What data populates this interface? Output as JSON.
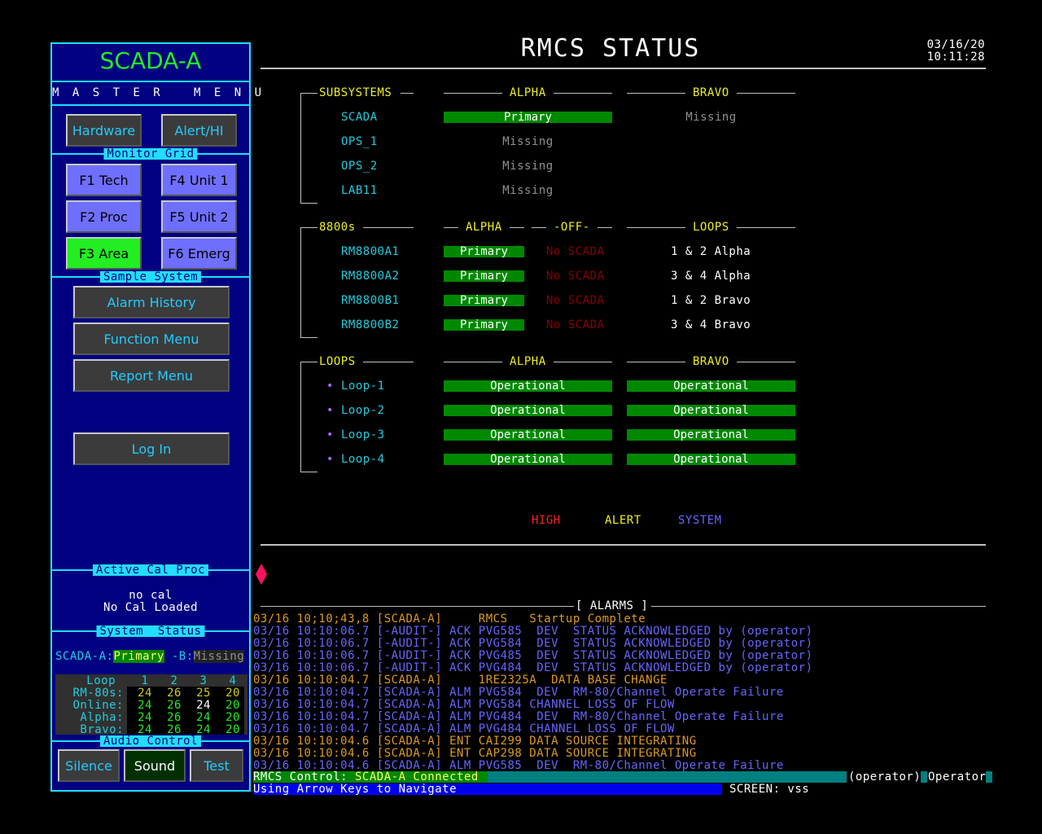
{
  "sidebar": {
    "title": "SCADA-A",
    "menu_label": "M A S T E R   M E N U",
    "hardware_btn": "Hardware",
    "alert_btn": "Alert/HI",
    "monitor_grid_label": "Monitor Grid",
    "monitor_grid": [
      "F1 Tech",
      "F4 Unit 1",
      "F2 Proc",
      "F5 Unit 2",
      "F3 Area",
      "F6 Emerg"
    ],
    "sample_system_label": "Sample System",
    "alarm_history_btn": "Alarm History",
    "function_menu_btn": "Function Menu",
    "report_menu_btn": "Report Menu",
    "login_btn": "Log In",
    "active_cal_label": "Active Cal Proc",
    "cal_line1": "no cal",
    "cal_line2": "No Cal Loaded",
    "system_status_label": "System  Status",
    "status_a_label": "SCADA-A:",
    "status_a_value": "Primary",
    "status_b_label": " -B:",
    "status_b_value": "Missing",
    "loop_table": {
      "headers": [
        "Loop",
        "1",
        "2",
        "3",
        "4"
      ],
      "rows": [
        {
          "label": "RM-80s:",
          "values": [
            "24",
            "26",
            "25",
            "20"
          ]
        },
        {
          "label": "Online:",
          "values": [
            "24",
            "26",
            "24",
            "20"
          ]
        },
        {
          "label": "Alpha:",
          "values": [
            "24",
            "26",
            "24",
            "20"
          ]
        },
        {
          "label": "Bravo:",
          "values": [
            "24",
            "26",
            "24",
            "20"
          ]
        }
      ]
    },
    "audio_control_label": "Audio Control",
    "silence_btn": "Silence",
    "sound_btn": "Sound",
    "test_btn": "Test"
  },
  "header": {
    "title": "RMCS STATUS",
    "date": "03/16/20",
    "time": "10:11:28"
  },
  "subsystems": {
    "header": "SUBSYSTEMS",
    "col_alpha": "ALPHA",
    "col_bravo": "BRAVO",
    "rows": [
      {
        "name": "SCADA",
        "alpha": "Primary",
        "bravo": "Missing"
      },
      {
        "name": "OPS_1",
        "alpha": "Missing",
        "bravo": ""
      },
      {
        "name": "OPS_2",
        "alpha": "Missing",
        "bravo": ""
      },
      {
        "name": "LAB11",
        "alpha": "Missing",
        "bravo": ""
      }
    ]
  },
  "rm8800s": {
    "header": "8800s",
    "col_alpha": "ALPHA",
    "col_off": "-OFF-",
    "col_loops": "LOOPS",
    "rows": [
      {
        "name": "RM8800A1",
        "alpha": "Primary",
        "off": "No SCADA",
        "loops": "1 & 2 Alpha"
      },
      {
        "name": "RM8800A2",
        "alpha": "Primary",
        "off": "No SCADA",
        "loops": "3 & 4 Alpha"
      },
      {
        "name": "RM8800B1",
        "alpha": "Primary",
        "off": "No SCADA",
        "loops": "1 & 2 Bravo"
      },
      {
        "name": "RM8800B2",
        "alpha": "Primary",
        "off": "No SCADA",
        "loops": "3 & 4 Bravo"
      }
    ]
  },
  "loops": {
    "header": "LOOPS",
    "col_alpha": "ALPHA",
    "col_bravo": "BRAVO",
    "bullet": "•",
    "rows": [
      {
        "name": "Loop-1",
        "alpha": "Operational",
        "bravo": "Operational"
      },
      {
        "name": "Loop-2",
        "alpha": "Operational",
        "bravo": "Operational"
      },
      {
        "name": "Loop-3",
        "alpha": "Operational",
        "bravo": "Operational"
      },
      {
        "name": "Loop-4",
        "alpha": "Operational",
        "bravo": "Operational"
      }
    ]
  },
  "legend": {
    "high": "HIGH",
    "alert": "ALERT",
    "system": "SYSTEM"
  },
  "alarms": {
    "header": "[ ALARMS ]",
    "lines": [
      {
        "text": "03/16 10;10;43,8 [SCADA-A]     RMCS   Startup Complete",
        "color": "#dd9922"
      },
      {
        "text": "03/16 10:10:06.7 [-AUDIT-] ACK PVG585  DEV  STATUS ACKNOWLEDGED by (operator)",
        "color": "#6666ff"
      },
      {
        "text": "03/16 10:10:06.7 [-AUDIT-] ACK PVG584  DEV  STATUS ACKNOWLEDGED by (operator)",
        "color": "#6666ff"
      },
      {
        "text": "03/16 10:10:06.7 [-AUDIT-] ACK PVG485  DEV  STATUS ACKNOWLEDGED by (operator)",
        "color": "#6666ff"
      },
      {
        "text": "03/16 10:10:06.7 [-AUDIT-] ACK PVG484  DEV  STATUS ACKNOWLEDGED by (operator)",
        "color": "#6666ff"
      },
      {
        "text": "03/16 10:10:04.7 [SCADA-A]     1RE2325A  DATA BASE CHANGE",
        "color": "#dd9922"
      },
      {
        "text": "03/16 10:10:04.7 [SCADA-A] ALM PVG584  DEV  RM-80/Channel Operate Failure",
        "color": "#6666ff"
      },
      {
        "text": "03/16 10:10:04.7 [SCADA-A] ALM PVG584 CHANNEL LOSS OF FLOW",
        "color": "#6666ff"
      },
      {
        "text": "03/16 10:10:04.7 [SCADA-A] ALM PVG484  DEV  RM-80/Channel Operate Failure",
        "color": "#6666ff"
      },
      {
        "text": "03/16 10:10:04.7 [SCADA-A] ALM PVG484 CHANNEL LOSS OF FLOW",
        "color": "#6666ff"
      },
      {
        "text": "03/16 10:10:04.6 [SCADA-A] ENT CAI299 DATA SOURCE INTEGRATING",
        "color": "#dd9922"
      },
      {
        "text": "03/16 10:10:04.6 [SCADA-A] ENT CAP298 DATA SOURCE INTEGRATING",
        "color": "#dd9922"
      },
      {
        "text": "03/16 10:10:04.6 [SCADA-A] ALM PVG585  DEV  RM-80/Channel Operate Failure",
        "color": "#6666ff"
      }
    ]
  },
  "statusbar": {
    "control_label": "RMCS Control:",
    "control_value": " SCADA-A Connected",
    "user": "(operator)",
    "role": "Operator",
    "hint": "Using Arrow Keys to Navigate",
    "screen": "SCREEN: vss"
  },
  "colors": {
    "sidebar_bg": "#000080",
    "sidebar_border": "#22ddff",
    "status_green": "#008800",
    "active_key": "#22ee22",
    "function_key": "#6f6fff",
    "high": "#ff2222",
    "alert": "#eeee22",
    "system": "#6666ff",
    "marker": "#ff1060"
  },
  "icons": {
    "cursor_marker": "diamond-marker-icon",
    "loop_bullet": "bullet-icon"
  }
}
